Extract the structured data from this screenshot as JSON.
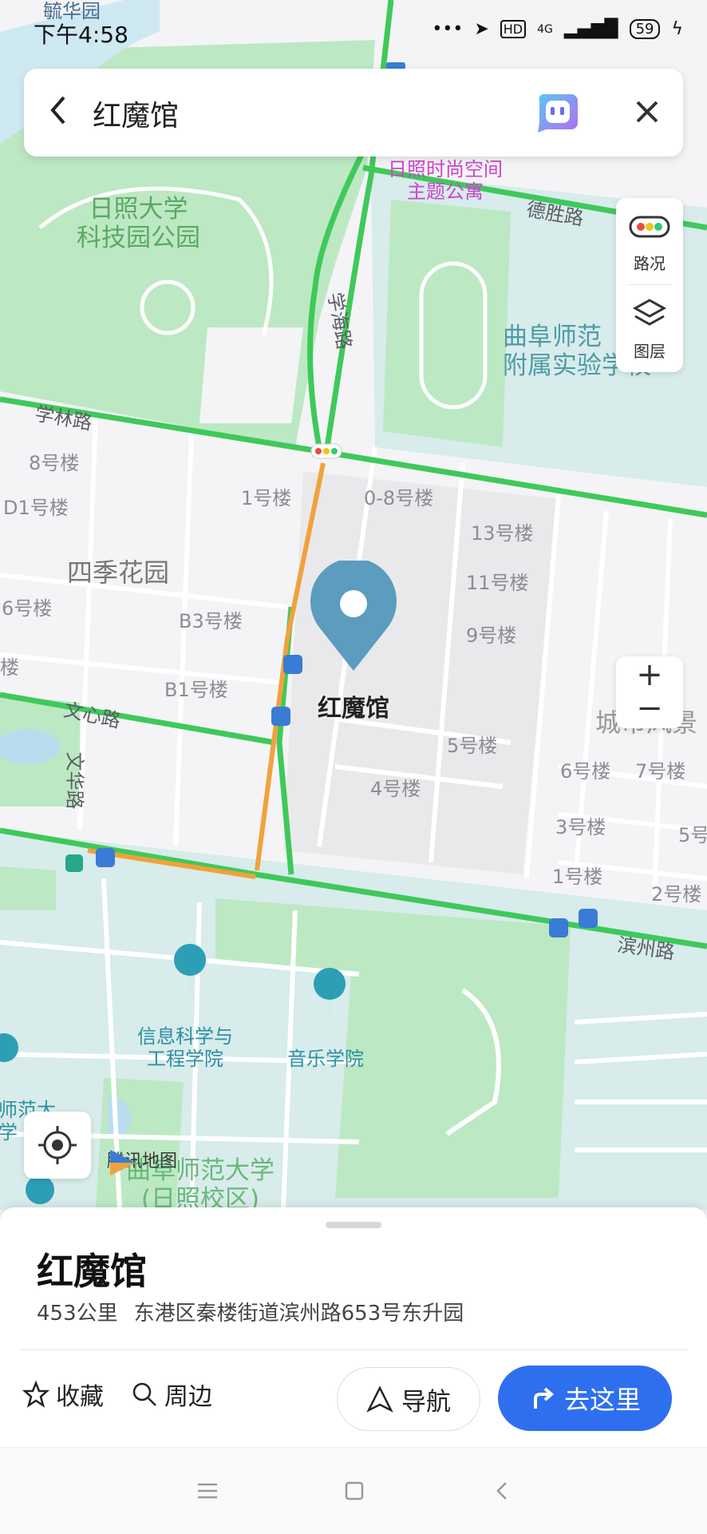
{
  "status_bar": {
    "time": "下午4:58",
    "network": "4G",
    "hd": "HD",
    "battery": "59"
  },
  "search": {
    "query": "红魔馆"
  },
  "side_panel": {
    "traffic_label": "路况",
    "layers_label": "图层"
  },
  "map": {
    "pin_label": "红魔馆",
    "labels": {
      "top_area": "毓华园",
      "park": "日照大学\n科技园公园",
      "apartment": "日照时尚空间\n主题公寓",
      "desheng_road": "德胜路",
      "school": "曲阜师范\n附属实验学校",
      "xuehai_road": "学海路",
      "xuelin_road": "学林路",
      "b8": "8号楼",
      "d1": "D1号楼",
      "b1": "1号楼",
      "b08": "0-8号楼",
      "b13": "13号楼",
      "siji": "四季花园",
      "b6l": "6号楼",
      "b11": "11号楼",
      "b3": "B3号楼",
      "b9": "9号楼",
      "bl": "楼",
      "bb1": "B1号楼",
      "wenxin_road": "文心路",
      "wenhua_road": "文华路",
      "chengshi": "城市风景",
      "b5": "5号楼",
      "b6": "6号楼",
      "b7": "7号楼",
      "b4": "4号楼",
      "b3r": "3号楼",
      "b5r": "5号",
      "b1r": "1号楼",
      "b2r": "2号楼",
      "binzhou_road": "滨州路",
      "info_college": "信息科学与\n工程学院",
      "music_college": "音乐学院",
      "qfnu_left": "师范大\n学",
      "qfnu_rizhao": "曲阜师范大学\n(日照校区)"
    },
    "logo": "腾讯地图",
    "colors": {
      "road_green": "#3fc95a",
      "road_orange": "#f0a23c",
      "pin": "#5b9cbf",
      "accent": "#2e6ff0"
    }
  },
  "zoom": {
    "in": "+",
    "out": "−"
  },
  "place": {
    "name": "红魔馆",
    "distance": "453公里",
    "address": "东港区秦楼街道滨州路653号东升园"
  },
  "actions": {
    "favorite": "收藏",
    "nearby": "周边",
    "navigate": "导航",
    "go_here": "去这里"
  },
  "icons": [
    "back-icon",
    "ai-assistant-icon",
    "close-icon",
    "traffic-icon",
    "layers-icon",
    "locate-icon",
    "star-icon",
    "search-icon",
    "navigate-icon",
    "turn-arrow-icon",
    "menu-icon",
    "home-icon",
    "back-nav-icon"
  ]
}
